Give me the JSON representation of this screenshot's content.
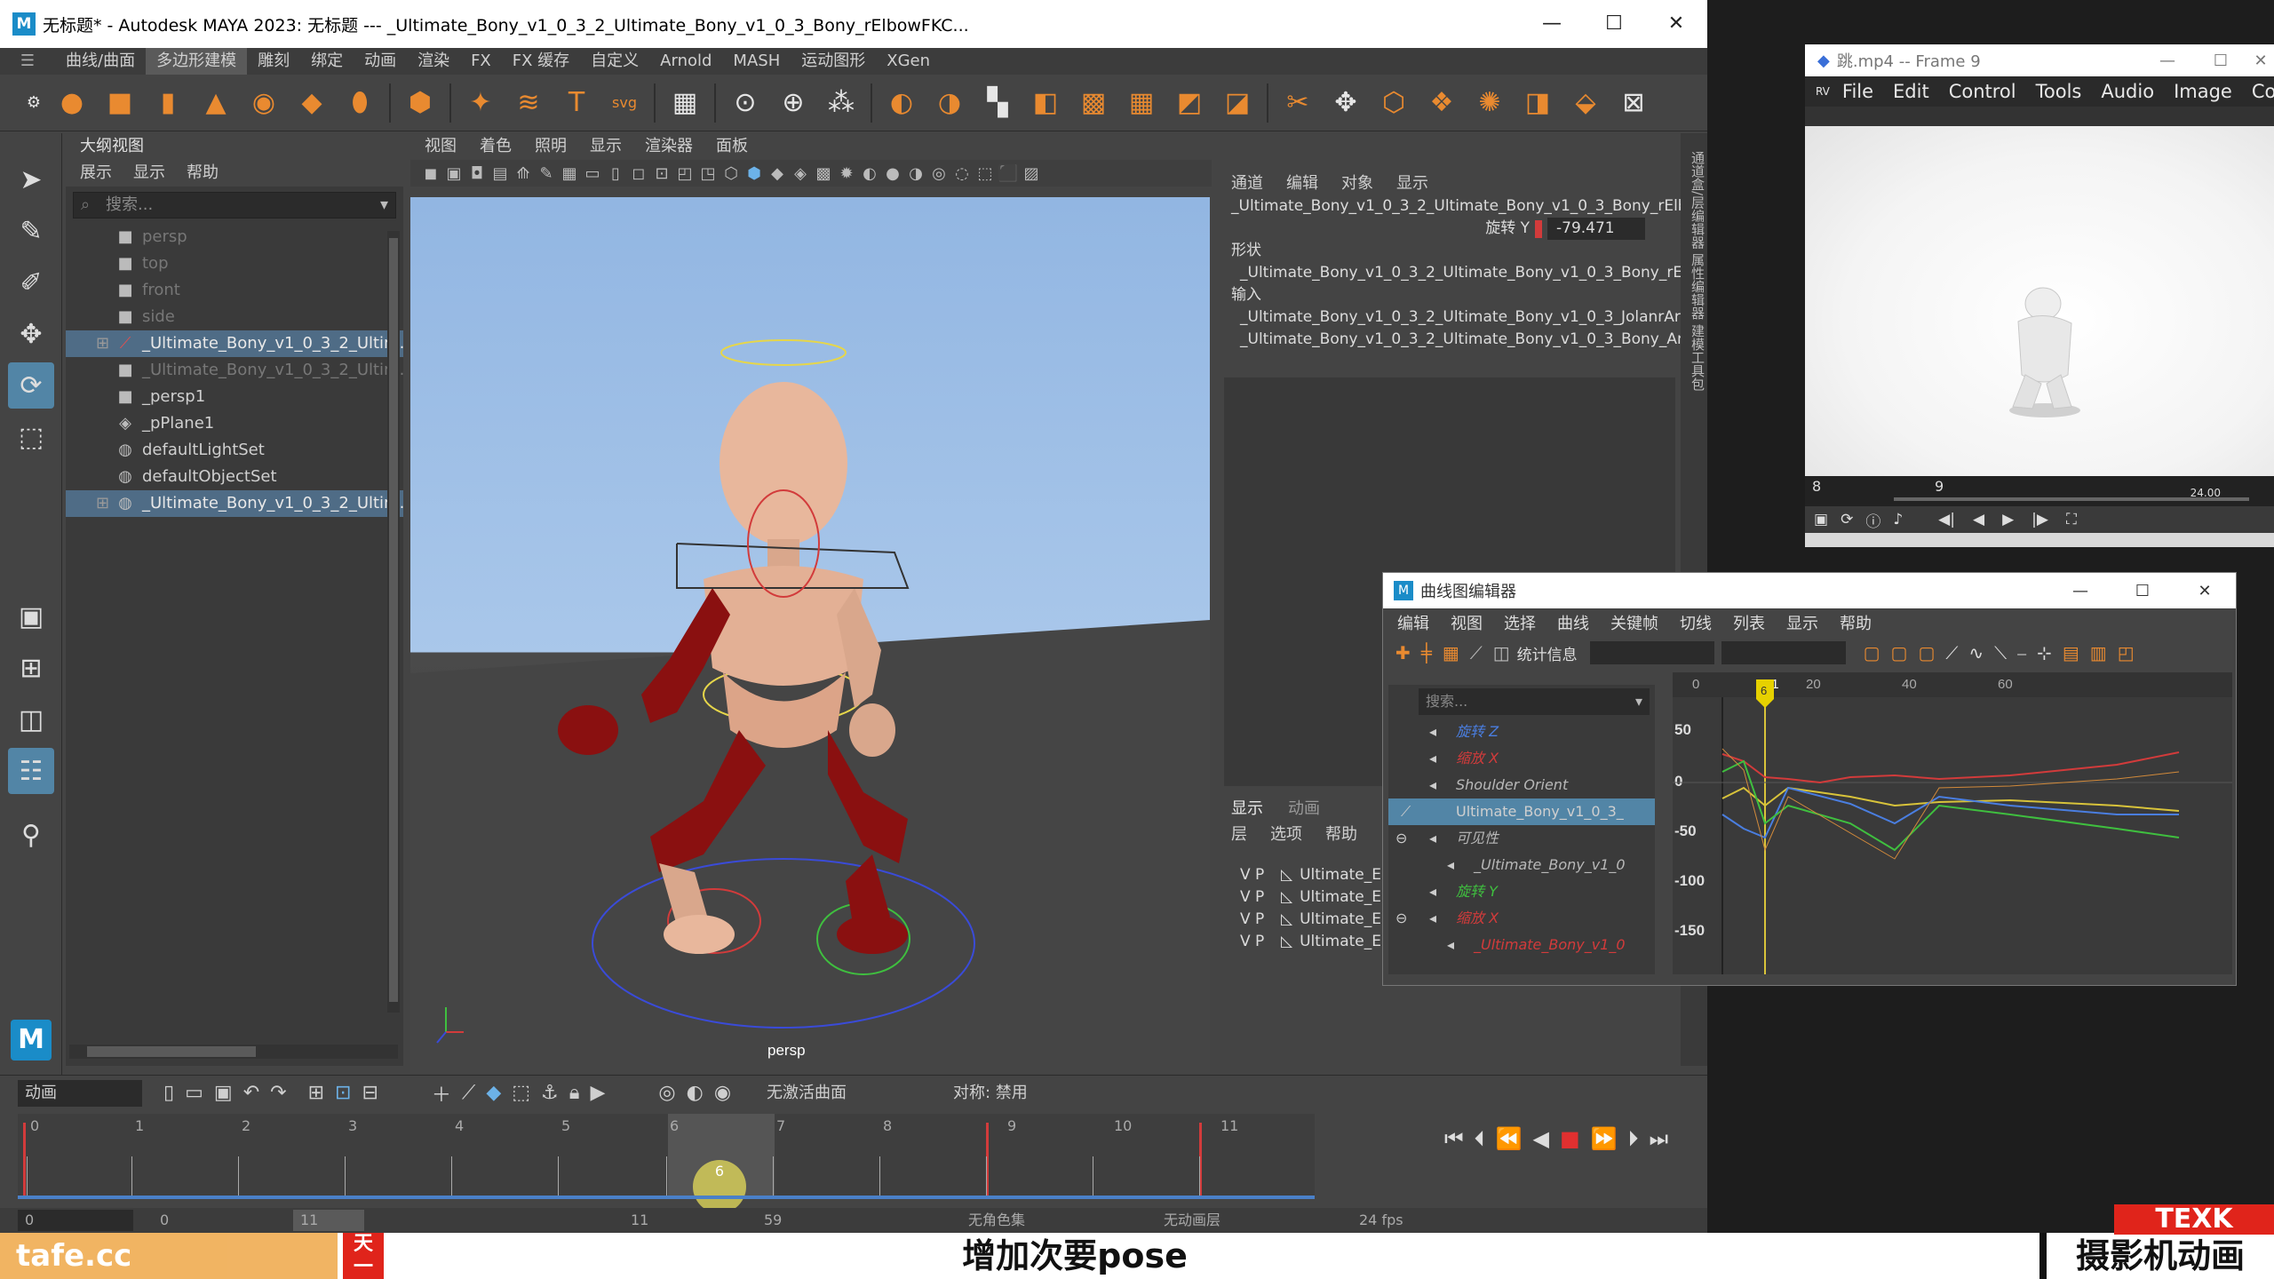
{
  "maya": {
    "title": "无标题* - Autodesk MAYA 2023: 无标题   ---   _Ultimate_Bony_v1_0_3_2_Ultimate_Bony_v1_0_3_Bony_rElbowFKC...",
    "menu": [
      "曲线/曲面",
      "多边形建模",
      "雕刻",
      "绑定",
      "动画",
      "渲染",
      "FX",
      "FX 缓存",
      "自定义",
      "Arnold",
      "MASH",
      "运动图形",
      "XGen"
    ],
    "active_menu": "多边形建模",
    "window_buttons": [
      "—",
      "☐",
      "✕"
    ]
  },
  "outliner": {
    "title": "大纲视图",
    "menus": [
      "展示",
      "显示",
      "帮助"
    ],
    "search_placeholder": "搜索...",
    "items": [
      {
        "label": "persp",
        "icon": "camera-icon"
      },
      {
        "label": "top",
        "icon": "camera-icon"
      },
      {
        "label": "front",
        "icon": "camera-icon"
      },
      {
        "label": "side",
        "icon": "camera-icon"
      },
      {
        "label": "_Ultimate_Bony_v1_0_3_2_Ultim...",
        "icon": "joint-icon"
      },
      {
        "label": "_Ultimate_Bony_v1_0_3_2_Ultim...",
        "icon": "camera-icon"
      },
      {
        "label": "_persp1",
        "icon": "camera-icon"
      },
      {
        "label": "_pPlane1",
        "icon": "mesh-icon"
      },
      {
        "label": "defaultLightSet",
        "icon": "set-icon"
      },
      {
        "label": "defaultObjectSet",
        "icon": "set-icon"
      },
      {
        "label": "_Ultimate_Bony_v1_0_3_2_Ultim...",
        "icon": "set-icon"
      }
    ]
  },
  "viewport": {
    "menus": [
      "视图",
      "着色",
      "照明",
      "显示",
      "渲染器",
      "面板"
    ],
    "camera_label": "persp"
  },
  "channel_box": {
    "menus": [
      "通道",
      "编辑",
      "对象",
      "显示"
    ],
    "node": "_Ultimate_Bony_v1_0_3_2_Ultimate_Bony_v1_0_3_Bony_rElb...",
    "attr_label": "旋转 Y",
    "attr_value": "-79.471",
    "shape_header": "形状",
    "shape": "_Ultimate_Bony_v1_0_3_2_Ultimate_Bony_v1_0_3_Bony_rEl...",
    "input_header": "输入",
    "inputs": [
      "_Ultimate_Bony_v1_0_3_2_Ultimate_Bony_v1_0_3_JolanrAr...",
      "_Ultimate_Bony_v1_0_3_2_Ultimate_Bony_v1_0_3_Bony_Arms"
    ],
    "layer_tabs": [
      "显示",
      "动画"
    ],
    "layer_menus": [
      "层",
      "选项",
      "帮助"
    ],
    "layers": [
      "Ultimate_E",
      "Ultimate_E",
      "Ultimate_E",
      "Ultimate_E"
    ]
  },
  "timeline": {
    "anim_set": "动画",
    "ticks": [
      "0",
      "1",
      "2",
      "3",
      "4",
      "5",
      "6",
      "7",
      "8",
      "9",
      "10",
      "11"
    ],
    "current_frame": "6",
    "curve_label": "无激活曲面",
    "symmetry": "对称: 禁用",
    "range_start": "0",
    "range_end": "11",
    "range_end2": "59",
    "fps": "24 fps",
    "char_set": "无角色集",
    "anim_layer": "无动画层"
  },
  "frame_viewer": {
    "title": "跳.mp4 -- Frame 9",
    "menus": [
      "File",
      "Edit",
      "Control",
      "Tools",
      "Audio",
      "Image",
      "Color"
    ],
    "frame_left": "8",
    "frame_mid": "9",
    "time_right": "24.00"
  },
  "graph_editor": {
    "title": "曲线图编辑器",
    "menus": [
      "编辑",
      "视图",
      "选择",
      "曲线",
      "关键帧",
      "切线",
      "列表",
      "显示",
      "帮助"
    ],
    "stats_label": "统计信息",
    "search_placeholder": "搜索...",
    "items": [
      {
        "label": "旋转 Z",
        "color": "#4a7ee0"
      },
      {
        "label": "缩放 X",
        "color": "#d23b3b"
      },
      {
        "label": "Shoulder Orient",
        "color": "#b8b8b8"
      },
      {
        "label": "Ultimate_Bony_v1_0_3_",
        "color": "#ffffff"
      },
      {
        "label": "可见性",
        "color": "#b8b8b8"
      },
      {
        "label": "_Ultimate_Bony_v1_0",
        "color": "#b8b8b8"
      },
      {
        "label": "旋转 Y",
        "color": "#3fbf3f"
      },
      {
        "label": "缩放 X",
        "color": "#d23b3b"
      },
      {
        "label": "_Ultimate_Bony_v1_0",
        "color": "#d23b3b"
      }
    ],
    "ruler": [
      "0",
      "6",
      "11",
      "20",
      "40",
      "60"
    ],
    "y_labels": [
      "50",
      "0",
      "-50",
      "-100",
      "-150"
    ],
    "current_frame": "6"
  },
  "overlay": {
    "subtitle": "增加次要pose",
    "right_label": "摄影机动画",
    "left_label": "tafe.cc",
    "brand": "TEXK"
  }
}
